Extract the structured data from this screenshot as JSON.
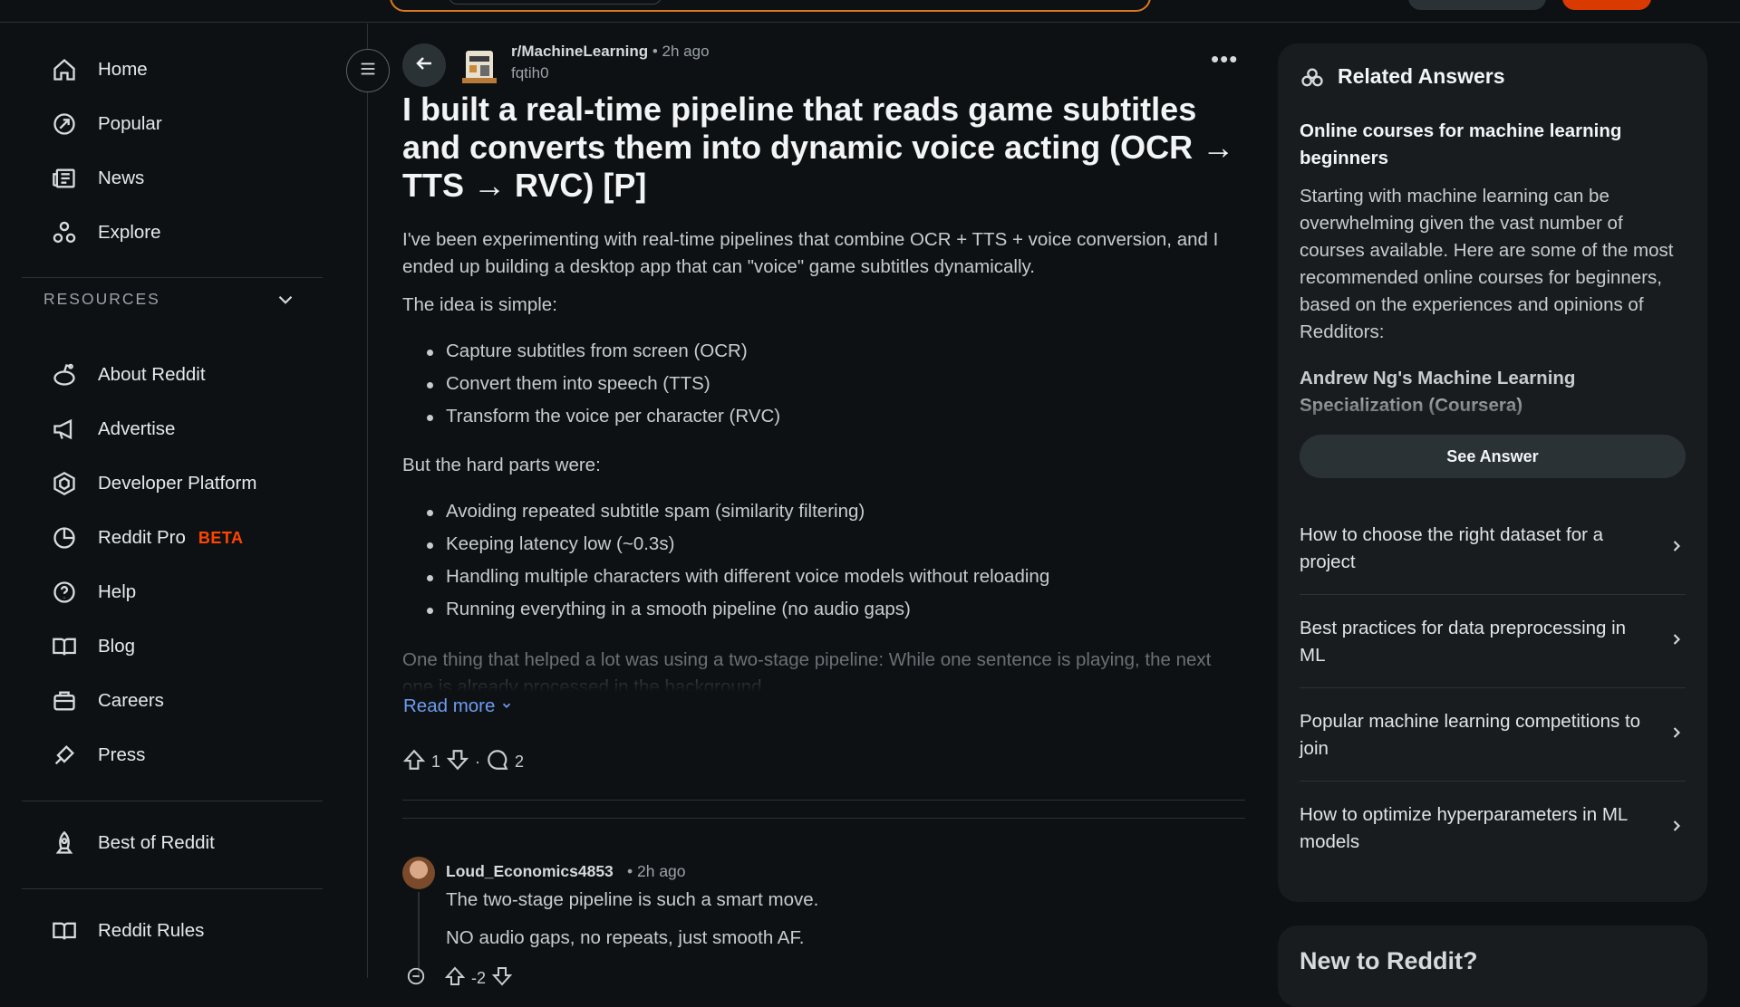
{
  "sidebar": {
    "items": [
      {
        "label": "Home",
        "icon": "home-icon"
      },
      {
        "label": "Popular",
        "icon": "popular-icon"
      },
      {
        "label": "News",
        "icon": "news-icon"
      },
      {
        "label": "Explore",
        "icon": "explore-icon"
      }
    ],
    "resources_heading": "RESOURCES",
    "resources": [
      {
        "label": "About Reddit",
        "icon": "reddit-alien-icon"
      },
      {
        "label": "Advertise",
        "icon": "megaphone-icon"
      },
      {
        "label": "Developer Platform",
        "icon": "developer-platform-icon"
      },
      {
        "label": "Reddit Pro",
        "icon": "pro-icon",
        "badge": "BETA"
      },
      {
        "label": "Help",
        "icon": "help-icon"
      },
      {
        "label": "Blog",
        "icon": "blog-icon"
      },
      {
        "label": "Careers",
        "icon": "briefcase-icon"
      },
      {
        "label": "Press",
        "icon": "press-icon"
      }
    ],
    "best_of": "Best of Reddit",
    "rules": "Reddit Rules"
  },
  "post": {
    "subreddit": "r/MachineLearning",
    "time": "• 2h ago",
    "author": "fqtih0",
    "title": "I built a real-time pipeline that reads game subtitles and converts them into dynamic voice acting (OCR → TTS → RVC) [P]",
    "intro": "I've been experimenting with real-time pipelines that combine OCR + TTS + voice conversion, and I ended up building a desktop app that can \"voice\" game subtitles dynamically.",
    "idea_line": "The idea is simple:",
    "idea_bullets": [
      "Capture subtitles from screen (OCR)",
      "Convert them into speech (TTS)",
      "Transform the voice per character (RVC)"
    ],
    "hard_line": "But the hard parts were:",
    "hard_bullets": [
      "Avoiding repeated subtitle spam (similarity filtering)",
      "Keeping latency low (~0.3s)",
      "Handling multiple characters with different voice models without reloading",
      "Running everything in a smooth pipeline (no audio gaps)"
    ],
    "faded_text": "One thing that helped a lot was using a two-stage pipeline: While one sentence is playing, the next one is already processed in the background.",
    "read_more": "Read more",
    "votes": "1",
    "separator": "·",
    "comments": "2"
  },
  "comment": {
    "author": "Loud_Economics4853",
    "time": "• 2h ago",
    "line1": "The two-stage pipeline is such a smart move.",
    "line2": "NO audio gaps, no repeats, just smooth AF.",
    "votes": "-2"
  },
  "related": {
    "title": "Related Answers",
    "question": "Online courses for machine learning beginners",
    "answer": "Starting with machine learning can be overwhelming given the vast number of courses available. Here are some of the most recommended online courses for beginners, based on the experiences and opinions of Redditors:",
    "answer_sub": "Andrew Ng's Machine Learning Specialization (Coursera)",
    "see_answer": "See Answer",
    "items": [
      "How to choose the right dataset for a project",
      "Best practices for data preprocessing in ML",
      "Popular machine learning competitions to join",
      "How to optimize hyperparameters in ML models"
    ]
  },
  "new_to_reddit": "New to Reddit?",
  "colors": {
    "accent": "#ff4500",
    "link": "#6d9bf0",
    "panel": "#181c1f",
    "bg": "#0e1113"
  }
}
